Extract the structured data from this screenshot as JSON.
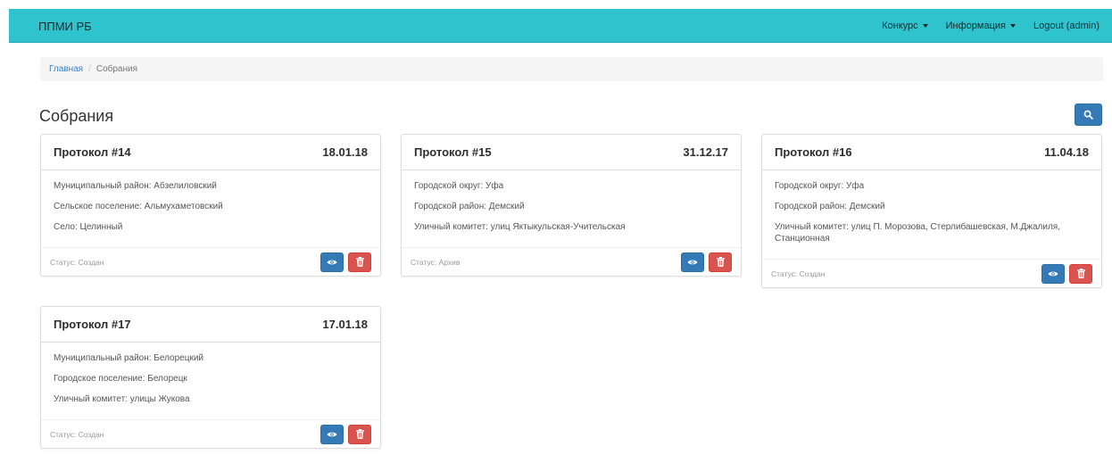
{
  "navbar": {
    "brand": "ППМИ РБ",
    "items": [
      {
        "label": "Конкурс",
        "dropdown": true
      },
      {
        "label": "Информация",
        "dropdown": true
      },
      {
        "label": "Logout (admin)",
        "dropdown": false
      }
    ]
  },
  "breadcrumb": {
    "home": "Главная",
    "separator": "/",
    "current": "Собрания"
  },
  "page": {
    "title": "Собрания",
    "search_icon": "search-icon"
  },
  "cards": [
    {
      "title": "Протокол #14",
      "date": "18.01.18",
      "lines": [
        "Муниципальный район: Абзелиловский",
        "Сельское поселение: Альмухаметовский",
        "Село: Целинный"
      ],
      "status": "Статус: Создан"
    },
    {
      "title": "Протокол #15",
      "date": "31.12.17",
      "lines": [
        "Городской округ: Уфа",
        "Городской район: Демский",
        "Уличный комитет: улиц Яктыкульская-Учительская"
      ],
      "status": "Статус: Архив"
    },
    {
      "title": "Протокол #16",
      "date": "11.04.18",
      "lines": [
        "Городской округ: Уфа",
        "Городской район: Демский",
        "Уличный комитет: улиц П. Морозова, Стерлибашевская, М.Джалиля, Станционная"
      ],
      "status": "Статус: Создан"
    },
    {
      "title": "Протокол #17",
      "date": "17.01.18",
      "lines": [
        "Муниципальный район: Белорецкий",
        "Городское поселение: Белорецк",
        "Уличный комитет: улицы Жукова"
      ],
      "status": "Статус: Создан"
    }
  ],
  "colors": {
    "navbar": "#2fc3cd",
    "primary": "#337ab7",
    "danger": "#d9534f"
  }
}
